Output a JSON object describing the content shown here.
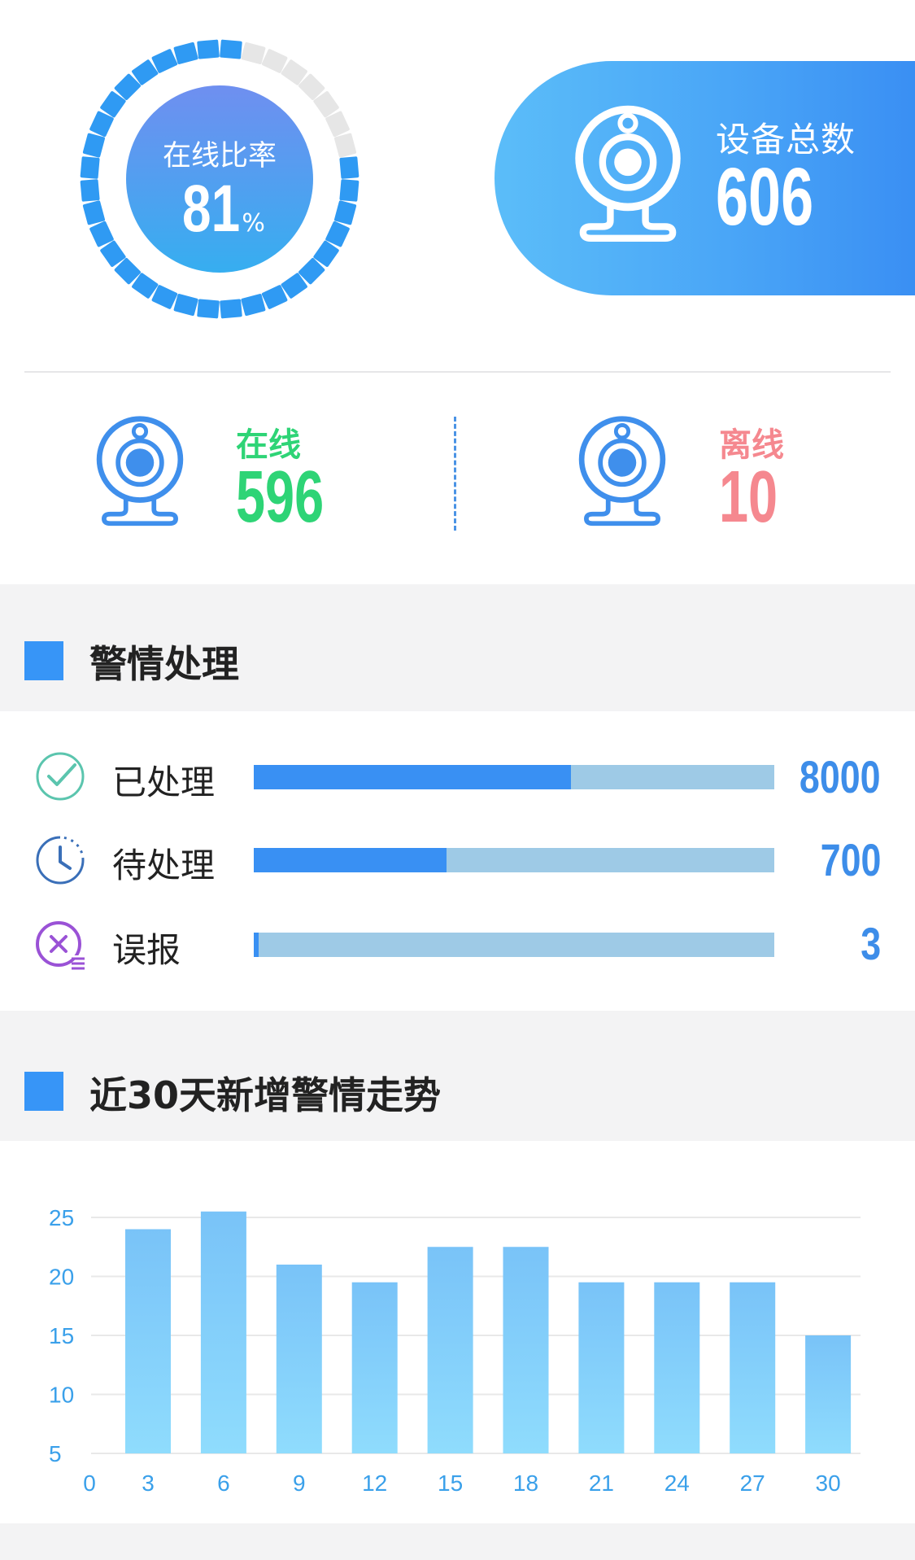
{
  "overview": {
    "online_rate": {
      "title": "在线比率",
      "value": "81",
      "unit": "%",
      "ring_fraction": 0.81
    },
    "total": {
      "label": "设备总数",
      "value": "606",
      "icon": "webcam-icon"
    },
    "online": {
      "label": "在线",
      "value": "596",
      "color": "#2ed476",
      "icon": "webcam-icon"
    },
    "offline": {
      "label": "离线",
      "value": "10",
      "color": "#f5888f",
      "icon": "webcam-icon"
    }
  },
  "alarm_section": {
    "title": "警情处理",
    "rows": [
      {
        "label": "已处理",
        "value": "8000",
        "fill_fraction": 0.61,
        "icon": "check-circle-icon"
      },
      {
        "label": "待处理",
        "value": "700",
        "fill_fraction": 0.37,
        "icon": "clock-icon"
      },
      {
        "label": "误报",
        "value": "3",
        "fill_fraction": 0.01,
        "icon": "cancel-list-icon"
      }
    ]
  },
  "trend_section": {
    "title": "近30天新增警情走势"
  },
  "chart_data": {
    "type": "bar",
    "title": "",
    "categories": [
      "3",
      "6",
      "9",
      "12",
      "15",
      "18",
      "21",
      "24",
      "27",
      "30"
    ],
    "values": [
      24,
      25.5,
      21,
      19.5,
      22.5,
      22.5,
      19.5,
      19.5,
      19.5,
      15
    ],
    "x_ticks": [
      "0",
      "3",
      "6",
      "9",
      "12",
      "15",
      "18",
      "21",
      "24",
      "27",
      "30"
    ],
    "y_ticks": [
      5,
      10,
      15,
      20,
      25
    ],
    "ylim": [
      5,
      25
    ],
    "grid": true,
    "colors": {
      "bar_top": "#79c3f8",
      "bar_bottom": "#8fdcfd",
      "tick": "#3aa0ea",
      "grid": "#e8e8e8"
    }
  }
}
